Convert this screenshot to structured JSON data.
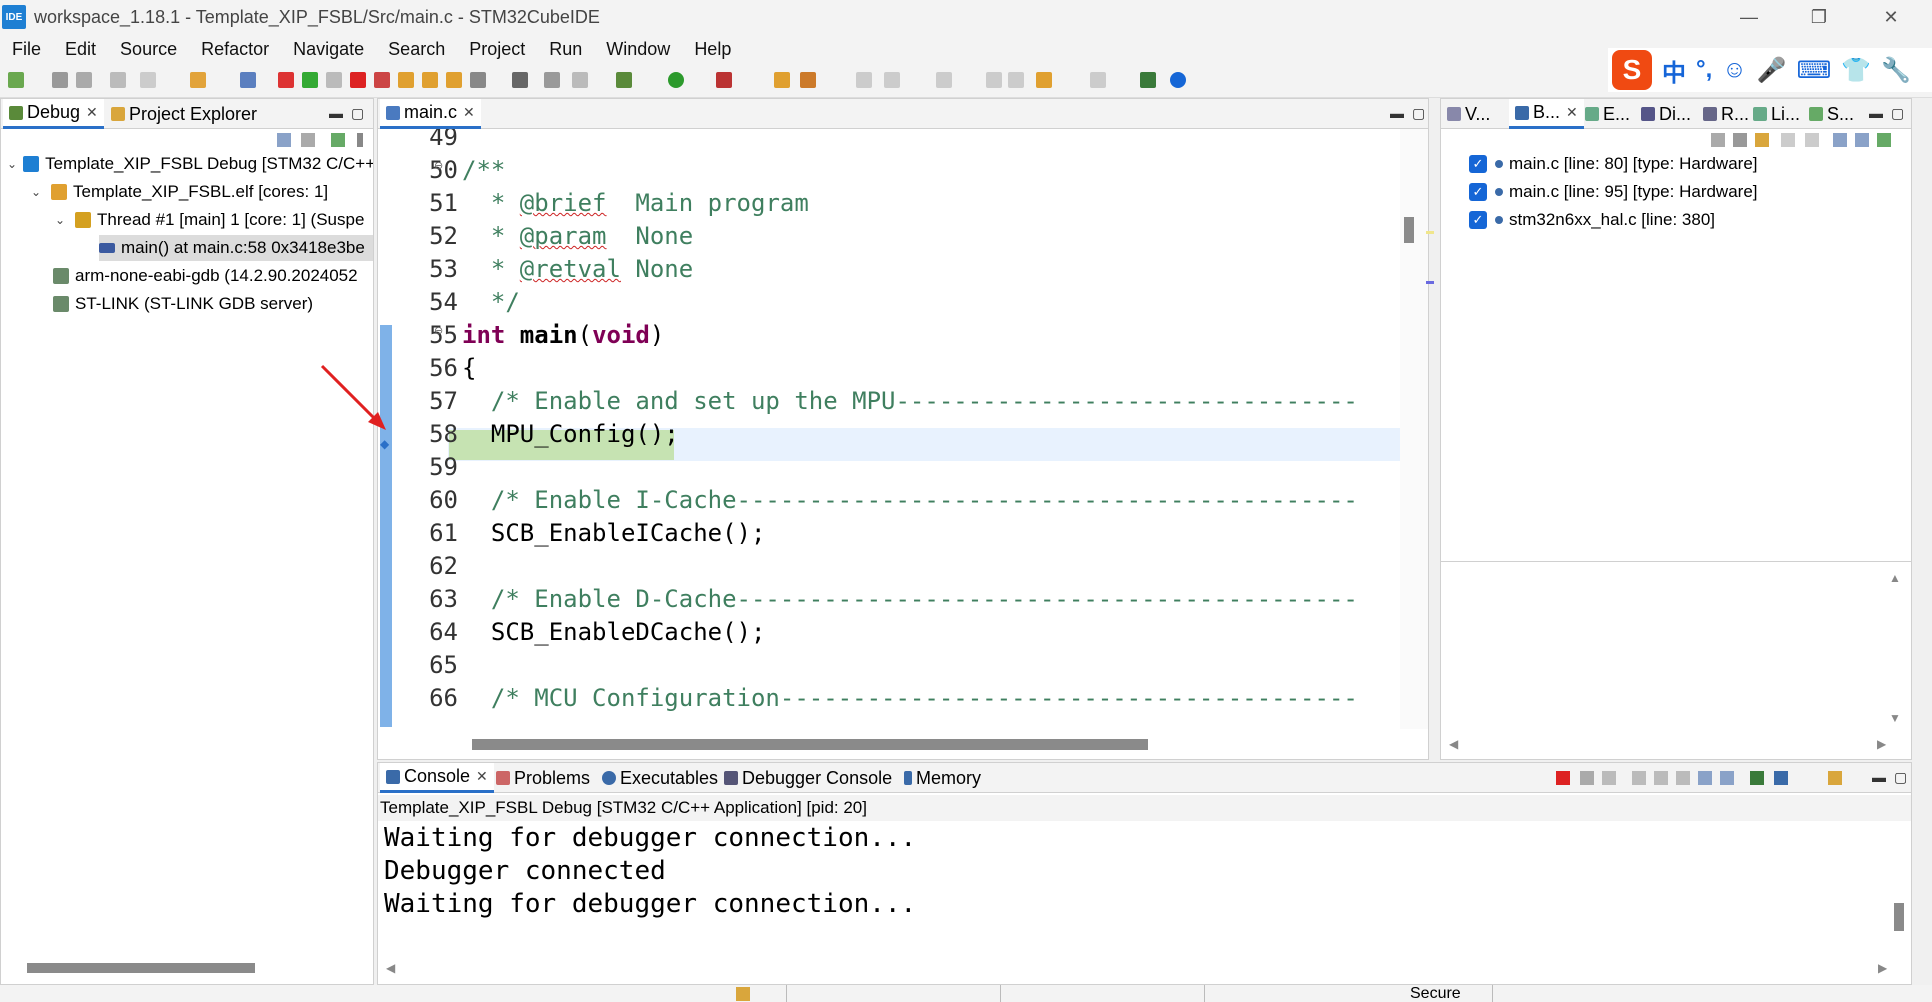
{
  "window": {
    "icon_text": "IDE",
    "title": "workspace_1.18.1 - Template_XIP_FSBL/Src/main.c - STM32CubeIDE",
    "minimize": "—",
    "restore": "❐",
    "close": "✕"
  },
  "menu": [
    "File",
    "Edit",
    "Source",
    "Refactor",
    "Navigate",
    "Search",
    "Project",
    "Run",
    "Window",
    "Help"
  ],
  "ime": {
    "logo": "S",
    "mode": "中",
    "punct": "°,",
    "emoji": "☺",
    "mic": "🎤",
    "keyboard": "⌨",
    "shirt": "👕",
    "wrench": "🔧"
  },
  "left_panel": {
    "tabs": [
      {
        "label": "Debug",
        "close": "✕"
      },
      {
        "label": "Project Explorer"
      }
    ],
    "tree": [
      {
        "label": "Template_XIP_FSBL Debug [STM32 C/C++",
        "twisty": "⌄"
      },
      {
        "label": "Template_XIP_FSBL.elf [cores: 1]",
        "twisty": "⌄"
      },
      {
        "label": "Thread #1 [main] 1 [core: 1] (Suspe",
        "twisty": "⌄"
      },
      {
        "label": "main() at main.c:58 0x3418e3be",
        "twisty": ""
      },
      {
        "label": "arm-none-eabi-gdb (14.2.90.2024052",
        "twisty": ""
      },
      {
        "label": "ST-LINK (ST-LINK GDB server)",
        "twisty": ""
      }
    ]
  },
  "editor": {
    "tab": {
      "label": "main.c",
      "close": "✕"
    },
    "lines": [
      {
        "n": "49",
        "fold": ""
      },
      {
        "n": "50",
        "fold": "⊖"
      },
      {
        "n": "51",
        "fold": ""
      },
      {
        "n": "52",
        "fold": ""
      },
      {
        "n": "53",
        "fold": ""
      },
      {
        "n": "54",
        "fold": ""
      },
      {
        "n": "55",
        "fold": "⊖"
      },
      {
        "n": "56",
        "fold": ""
      },
      {
        "n": "57",
        "fold": ""
      },
      {
        "n": "58",
        "fold": ""
      },
      {
        "n": "59",
        "fold": ""
      },
      {
        "n": "60",
        "fold": ""
      },
      {
        "n": "61",
        "fold": ""
      },
      {
        "n": "62",
        "fold": ""
      },
      {
        "n": "63",
        "fold": ""
      },
      {
        "n": "64",
        "fold": ""
      },
      {
        "n": "65",
        "fold": ""
      },
      {
        "n": "66",
        "fold": ""
      }
    ],
    "code": {
      "l50": "/**",
      "l51a": "  * ",
      "l51b": "@brief",
      "l51c": "  Main program",
      "l52a": "  * ",
      "l52b": "@param",
      "l52c": "  None",
      "l53a": "  * ",
      "l53b": "@retval",
      "l53c": " None",
      "l54": "  */",
      "l55a": "int",
      "l55b": " main",
      "l55c": "(",
      "l55d": "void",
      "l55e": ")",
      "l56": "{",
      "l57": "  /* Enable and set up the MPU--------------------------------",
      "l58": "  MPU_Config();",
      "l60": "  /* Enable I-Cache-------------------------------------------",
      "l61": "  SCB_EnableICache();",
      "l63": "  /* Enable D-Cache-------------------------------------------",
      "l64": "  SCB_EnableDCache();",
      "l66": "  /* MCU Configuration----------------------------------------"
    },
    "current_line": "58"
  },
  "right_panel": {
    "tabs": [
      {
        "label": "V..."
      },
      {
        "label": "B...",
        "close": "✕"
      },
      {
        "label": "E..."
      },
      {
        "label": "Di..."
      },
      {
        "label": "R..."
      },
      {
        "label": "Li..."
      },
      {
        "label": "S..."
      }
    ],
    "breakpoints": [
      {
        "label": "main.c [line: 80] [type: Hardware]",
        "checked": "✓"
      },
      {
        "label": "main.c [line: 95] [type: Hardware]",
        "checked": "✓"
      },
      {
        "label": "stm32n6xx_hal.c [line: 380]",
        "checked": "✓"
      }
    ]
  },
  "bottom_panel": {
    "tabs": [
      {
        "label": "Console",
        "close": "✕"
      },
      {
        "label": "Problems"
      },
      {
        "label": "Executables"
      },
      {
        "label": "Debugger Console"
      },
      {
        "label": "Memory"
      }
    ],
    "session": "Template_XIP_FSBL Debug [STM32 C/C++ Application]  [pid: 20]",
    "output": [
      "Waiting for debugger connection...",
      "Debugger connected",
      "Waiting for debugger connection..."
    ]
  },
  "statusbar": {
    "secure": "Secure"
  },
  "colors": {
    "accent": "#2a70c8",
    "comment": "#3f7f5f",
    "keyword": "#7f0055",
    "current_line": "#e8f2fe",
    "arrow": "#e02020"
  }
}
